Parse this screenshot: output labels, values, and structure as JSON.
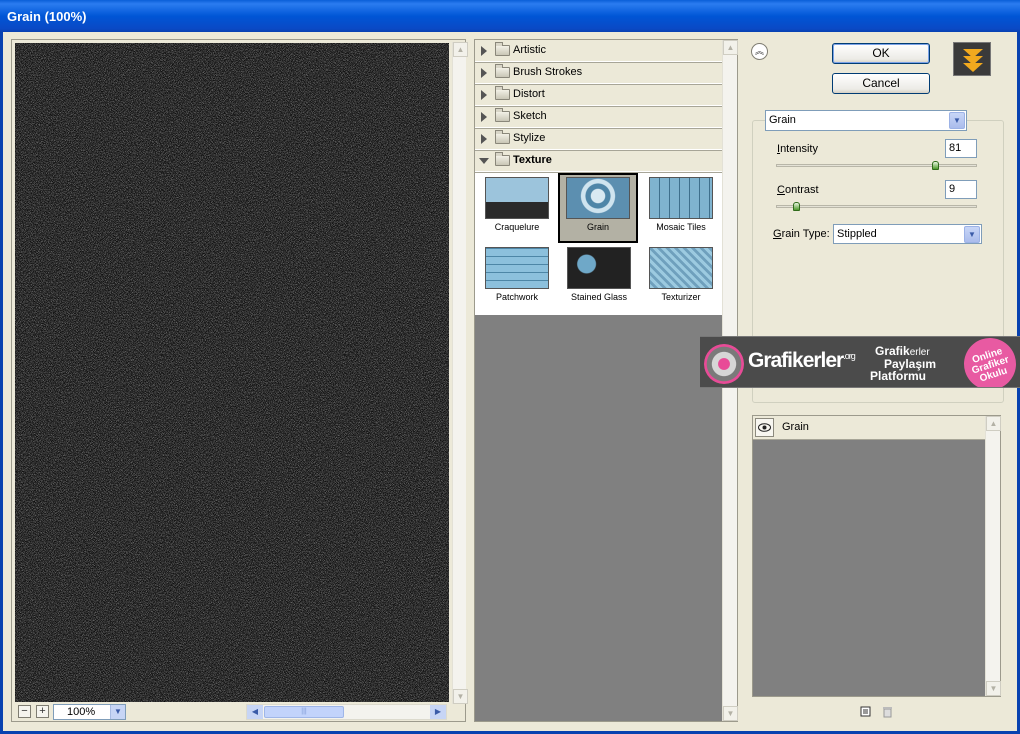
{
  "window": {
    "title": "Grain (100%)"
  },
  "preview": {
    "zoom_value": "100%",
    "zoom_out_glyph": "−",
    "zoom_in_glyph": "+"
  },
  "filter_categories": [
    {
      "label": "Artistic",
      "expanded": false
    },
    {
      "label": "Brush Strokes",
      "expanded": false
    },
    {
      "label": "Distort",
      "expanded": false
    },
    {
      "label": "Sketch",
      "expanded": false
    },
    {
      "label": "Stylize",
      "expanded": false
    },
    {
      "label": "Texture",
      "expanded": true
    }
  ],
  "texture_filters": [
    {
      "label": "Craquelure",
      "selected": false
    },
    {
      "label": "Grain",
      "selected": true
    },
    {
      "label": "Mosaic Tiles",
      "selected": false
    },
    {
      "label": "Patchwork",
      "selected": false
    },
    {
      "label": "Stained Glass",
      "selected": false
    },
    {
      "label": "Texturizer",
      "selected": false
    }
  ],
  "buttons": {
    "ok": "OK",
    "cancel": "Cancel"
  },
  "settings": {
    "filter_name": "Grain",
    "intensity": {
      "label": "Intensity",
      "mnemonic": "I",
      "rest": "ntensity",
      "value": "81",
      "max": 100
    },
    "contrast": {
      "label": "Contrast",
      "mnemonic": "C",
      "rest": "ontrast",
      "value": "9",
      "max": 100
    },
    "grain_type": {
      "label": "Grain Type:",
      "mnemonic": "G",
      "rest": "rain Type:",
      "value": "Stippled"
    }
  },
  "watermark": {
    "brand": "Grafikerler",
    "brand_suffix": ".org",
    "tag_1": "Grafik",
    "tag_1b": "erler",
    "tag_2": "Paylaşım",
    "tag_3": "Platformu",
    "badge": [
      "Online",
      "Grafiker",
      "Okulu"
    ]
  },
  "effect_layers": [
    {
      "name": "Grain",
      "visible": true
    }
  ],
  "icons": {
    "dialog_toggle": "double-chevron-up-icon",
    "ps_logo": "triple-chevron-down-icon",
    "new_layer": "new-effect-layer-icon",
    "delete_layer": "trash-icon",
    "visibility": "eye-icon",
    "folder": "folder-icon"
  },
  "colors": {
    "title_bar": "#0056d6",
    "dialog_bg": "#ece9d8",
    "preview_noise_dark": "#0b0b0b",
    "preview_noise_light": "#ffffff",
    "accent_orange": "#f2a91e"
  }
}
